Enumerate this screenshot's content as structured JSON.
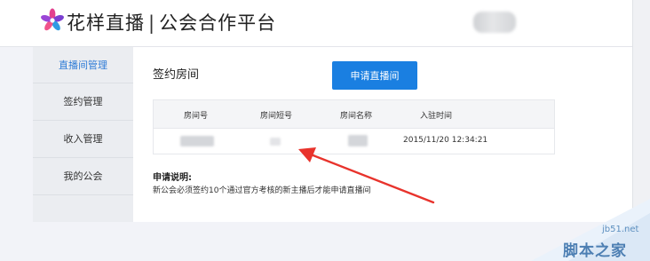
{
  "header": {
    "brand": "花样直播",
    "separator": "|",
    "platform": "公会合作平台"
  },
  "sidebar": {
    "items": [
      {
        "label": "直播间管理",
        "active": true
      },
      {
        "label": "签约管理",
        "active": false
      },
      {
        "label": "收入管理",
        "active": false
      },
      {
        "label": "我的公会",
        "active": false
      }
    ]
  },
  "main": {
    "title": "签约房间",
    "apply_button": "申请直播间",
    "table": {
      "columns": [
        "房间号",
        "房间短号",
        "房间名称",
        "入驻时间"
      ],
      "rows": [
        {
          "room_id": "",
          "short_id": "",
          "room_name": "",
          "joined_at": "2015/11/20 12:34:21"
        }
      ]
    },
    "note_title": "申请说明:",
    "note_text": "新公会必须签约10个通过官方考核的新主播后才能申请直播间"
  },
  "watermark": {
    "site": "jb51.net",
    "name": "脚本之家"
  },
  "colors": {
    "accent": "#1a7fe1",
    "active_link": "#2e7bd6",
    "annotation_arrow": "#e8332c"
  }
}
